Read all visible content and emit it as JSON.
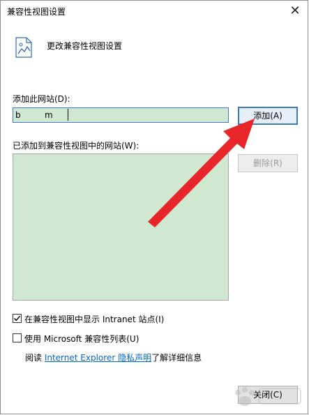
{
  "window": {
    "title": "兼容性视图设置",
    "close_glyph": "✕"
  },
  "header": {
    "text": "更改兼容性视图设置",
    "icon": "page-settings-icon"
  },
  "add_site": {
    "label": "添加此网站(D):",
    "value": "b         m",
    "add_button": "添加(A)"
  },
  "site_list": {
    "label": "已添加到兼容性视图中的网站(W):",
    "items": [],
    "remove_button": "删除(R)"
  },
  "options": {
    "intranet": {
      "label": "在兼容性视图中显示 Intranet 站点(I)",
      "checked": true
    },
    "microsoft_list": {
      "label": "使用 Microsoft 兼容性列表(U)",
      "checked": false
    }
  },
  "privacy": {
    "prefix": "阅读 ",
    "link": "Internet Explorer 隐私声明",
    "suffix": "了解详细信息"
  },
  "footer": {
    "close_button": "关闭(C)"
  },
  "colors": {
    "highlight_green": "#cfe8cf",
    "arrow_red": "#e8262a",
    "focus_blue": "#3c78c4",
    "link_blue": "#0066cc"
  }
}
